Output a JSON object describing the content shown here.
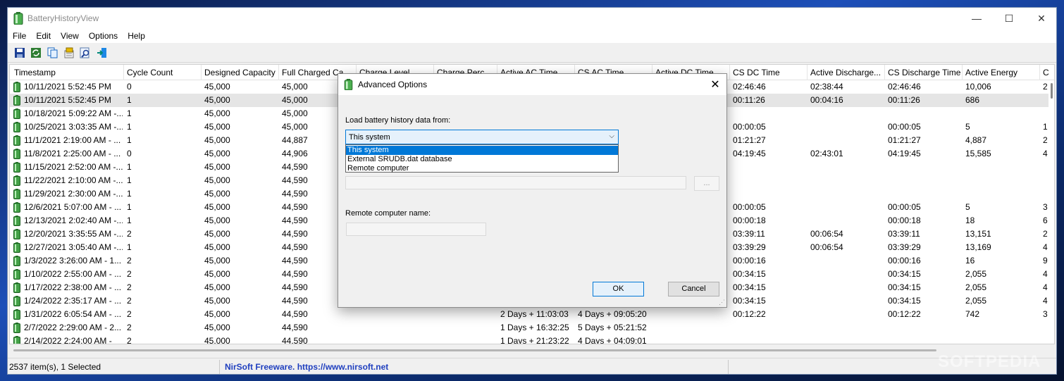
{
  "window": {
    "title": "BatteryHistoryView",
    "minimize": "—",
    "maximize": "☐",
    "close": "✕"
  },
  "menu": [
    "File",
    "Edit",
    "View",
    "Options",
    "Help"
  ],
  "toolbar": [
    "save-icon",
    "refresh-icon",
    "copy-icon",
    "properties-icon",
    "find-icon",
    "exit-icon"
  ],
  "columns": [
    "Timestamp",
    "Cycle Count",
    "Designed Capacity",
    "Full Charged Ca...",
    "Charge Level",
    "Charge Perc...",
    "Active AC Time",
    "CS AC Time",
    "Active DC Time",
    "CS DC Time",
    "Active Discharge...",
    "CS Discharge Time",
    "Active Energy",
    "C"
  ],
  "rows": [
    [
      "10/11/2021 5:52:45 PM",
      "0",
      "45,000",
      "45,000",
      "",
      "",
      "",
      "",
      "",
      "02:46:46",
      "02:38:44",
      "02:46:46",
      "10,006",
      "2"
    ],
    [
      "10/11/2021 5:52:45 PM",
      "1",
      "45,000",
      "45,000",
      "",
      "",
      "",
      "",
      "",
      "00:11:26",
      "00:04:16",
      "00:11:26",
      "686",
      ""
    ],
    [
      "10/18/2021 5:09:22 AM -...",
      "1",
      "45,000",
      "45,000",
      "",
      "",
      "",
      "",
      "",
      "",
      "",
      "",
      "",
      ""
    ],
    [
      "10/25/2021 3:03:35 AM -...",
      "1",
      "45,000",
      "45,000",
      "",
      "",
      "",
      "",
      "",
      "00:00:05",
      "",
      "00:00:05",
      "5",
      "1"
    ],
    [
      "11/1/2021 2:19:00 AM - ...",
      "1",
      "45,000",
      "44,887",
      "",
      "",
      "",
      "",
      "",
      "01:21:27",
      "",
      "01:21:27",
      "4,887",
      "2"
    ],
    [
      "11/8/2021 2:25:00 AM - ...",
      "0",
      "45,000",
      "44,906",
      "",
      "",
      "",
      "",
      "",
      "04:19:45",
      "02:43:01",
      "04:19:45",
      "15,585",
      "4"
    ],
    [
      "11/15/2021 2:52:00 AM -...",
      "1",
      "45,000",
      "44,590",
      "",
      "",
      "",
      "",
      "",
      "",
      "",
      "",
      "",
      ""
    ],
    [
      "11/22/2021 2:10:00 AM -...",
      "1",
      "45,000",
      "44,590",
      "",
      "",
      "",
      "",
      "",
      "",
      "",
      "",
      "",
      ""
    ],
    [
      "11/29/2021 2:30:00 AM -...",
      "1",
      "45,000",
      "44,590",
      "",
      "",
      "",
      "",
      "",
      "",
      "",
      "",
      "",
      ""
    ],
    [
      "12/6/2021 5:07:00 AM - ...",
      "1",
      "45,000",
      "44,590",
      "",
      "",
      "",
      "",
      "",
      "00:00:05",
      "",
      "00:00:05",
      "5",
      "3"
    ],
    [
      "12/13/2021 2:02:40 AM -...",
      "1",
      "45,000",
      "44,590",
      "",
      "",
      "",
      "",
      "",
      "00:00:18",
      "",
      "00:00:18",
      "18",
      "6"
    ],
    [
      "12/20/2021 3:35:55 AM -...",
      "2",
      "45,000",
      "44,590",
      "",
      "",
      "",
      "",
      "",
      "03:39:11",
      "00:06:54",
      "03:39:11",
      "13,151",
      "2"
    ],
    [
      "12/27/2021 3:05:40 AM -...",
      "1",
      "45,000",
      "44,590",
      "",
      "",
      "",
      "",
      "",
      "03:39:29",
      "00:06:54",
      "03:39:29",
      "13,169",
      "4"
    ],
    [
      "1/3/2022 3:26:00 AM - 1...",
      "2",
      "45,000",
      "44,590",
      "",
      "",
      "",
      "",
      "",
      "00:00:16",
      "",
      "00:00:16",
      "16",
      "9"
    ],
    [
      "1/10/2022 2:55:00 AM - ...",
      "2",
      "45,000",
      "44,590",
      "",
      "",
      "",
      "",
      "",
      "00:34:15",
      "",
      "00:34:15",
      "2,055",
      "4"
    ],
    [
      "1/17/2022 2:38:00 AM - ...",
      "2",
      "45,000",
      "44,590",
      "",
      "",
      "",
      "",
      "",
      "00:34:15",
      "",
      "00:34:15",
      "2,055",
      "4"
    ],
    [
      "1/24/2022 2:35:17 AM - ...",
      "2",
      "45,000",
      "44,590",
      "",
      "",
      "",
      "",
      "",
      "00:34:15",
      "",
      "00:34:15",
      "2,055",
      "4"
    ],
    [
      "1/31/2022 6:05:54 AM - ...",
      "2",
      "45,000",
      "44,590",
      "",
      "",
      "2 Days + 11:03:03",
      "4 Days + 09:05:20",
      "",
      "00:12:22",
      "",
      "00:12:22",
      "742",
      "3"
    ],
    [
      "2/7/2022 2:29:00 AM - 2...",
      "2",
      "45,000",
      "44,590",
      "",
      "",
      "1 Days + 16:32:25",
      "5 Days + 05:21:52",
      "",
      "",
      "",
      "",
      "",
      ""
    ],
    [
      "2/14/2022 2:24:00 AM -",
      "2",
      "45,000",
      "44,590",
      "",
      "",
      "1 Days + 21:23:22",
      "4 Days + 04:09:01",
      "",
      "",
      "",
      "",
      "",
      ""
    ]
  ],
  "status": {
    "count": "2537 item(s), 1 Selected",
    "link": "NirSoft Freeware. https://www.nirsoft.net"
  },
  "watermark": "SOFTPEDIA",
  "dialog": {
    "title": "Advanced Options",
    "close": "✕",
    "load_label": "Load battery history data from:",
    "combo_value": "This system",
    "combo_arrow": "⌵",
    "options": [
      "This system",
      "External SRUDB.dat database",
      "Remote computer"
    ],
    "browse": "...",
    "remote_label": "Remote computer name:",
    "ok": "OK",
    "cancel": "Cancel",
    "grip": "⋰"
  }
}
